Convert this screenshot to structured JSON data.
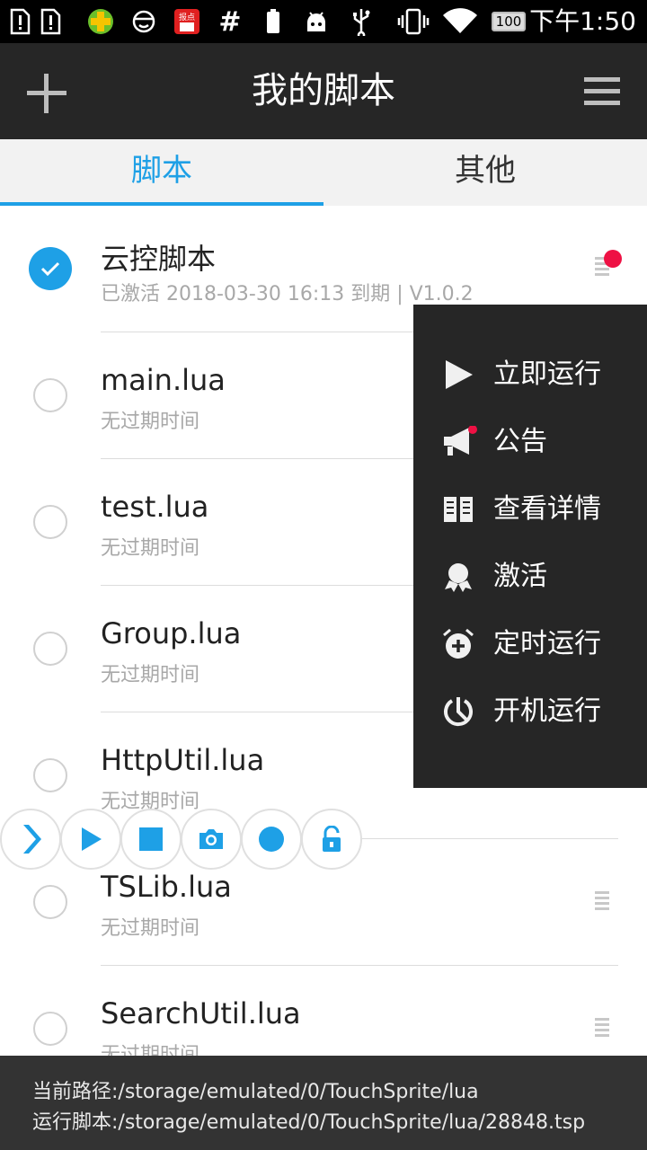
{
  "status_bar": {
    "time": "下午1:50",
    "battery_level": "100",
    "calendar_icon_text": "报点",
    "hash": "#",
    "icons": [
      "sim-alert-icon",
      "sim-alert-icon",
      "plus-ball-icon",
      "smiley-icon",
      "calendar-icon",
      "hash-icon",
      "battery-small-icon",
      "android-icon",
      "usb-icon",
      "vibrate-icon",
      "wifi-icon",
      "battery-icon"
    ]
  },
  "app_bar": {
    "title": "我的脚本",
    "add_icon": "plus-icon",
    "menu_icon": "hamburger-menu-icon"
  },
  "tabs": [
    {
      "label": "脚本",
      "active": true
    },
    {
      "label": "其他",
      "active": false
    }
  ],
  "scripts": [
    {
      "name": "云控脚本",
      "subtitle": "已激活 2018-03-30 16:13 到期 | V1.0.2",
      "checked": true,
      "has_badge": true
    },
    {
      "name": "main.lua",
      "subtitle": "无过期时间",
      "checked": false
    },
    {
      "name": "test.lua",
      "subtitle": "无过期时间",
      "checked": false
    },
    {
      "name": "Group.lua",
      "subtitle": "无过期时间",
      "checked": false
    },
    {
      "name": "HttpUtil.lua",
      "subtitle": "无过期时间",
      "checked": false
    },
    {
      "name": "TSLib.lua",
      "subtitle": "无过期时间",
      "checked": false
    },
    {
      "name": "SearchUtil.lua",
      "subtitle": "无过期时间",
      "checked": false
    }
  ],
  "popup_menu": {
    "items": [
      {
        "label": "立即运行",
        "icon": "play-icon"
      },
      {
        "label": "公告",
        "icon": "megaphone-icon",
        "badge": true
      },
      {
        "label": "查看详情",
        "icon": "book-icon"
      },
      {
        "label": "激活",
        "icon": "award-icon"
      },
      {
        "label": "定时运行",
        "icon": "alarm-clock-icon"
      },
      {
        "label": "开机运行",
        "icon": "power-timer-icon"
      }
    ]
  },
  "floating_toolbar": {
    "buttons": [
      "expand-chevron-icon",
      "play-icon",
      "stop-icon",
      "camera-icon",
      "record-icon",
      "unlock-icon"
    ]
  },
  "bottom_info": {
    "current_path": "当前路径:/storage/emulated/0/TouchSprite/lua",
    "running_script": "运行脚本:/storage/emulated/0/TouchSprite/lua/28848.tsp"
  },
  "colors": {
    "accent": "#1ea0e6",
    "app_bar": "#262626",
    "badge": "#ee1144",
    "bottom_bar": "#333333"
  }
}
